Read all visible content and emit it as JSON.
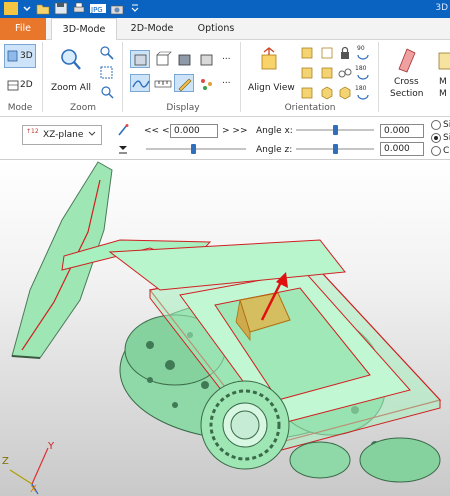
{
  "window": {
    "title": "3D"
  },
  "tabs": [
    {
      "label": "File"
    },
    {
      "label": "3D-Mode"
    },
    {
      "label": "2D-Mode"
    },
    {
      "label": "Options"
    }
  ],
  "ribbon": {
    "mode": {
      "btn_3d": "3D",
      "btn_2d": "2D",
      "label": "Mode"
    },
    "zoom": {
      "zoom_all": "Zoom All",
      "label": "Zoom"
    },
    "display": {
      "label": "Display",
      "more": "..."
    },
    "orientation": {
      "align_view": "Align View",
      "label": "Orientation",
      "rot_90": "90",
      "rot_180a": "180",
      "rot_180b": "180"
    },
    "cross_section": {
      "line1": "Cross",
      "line2": "Section"
    },
    "cut": {
      "line1": "M",
      "line2": "M"
    }
  },
  "toolbar": {
    "plane": "XZ-plane",
    "plane_badge": "↑12",
    "step_left": "<<  <",
    "step_right": ">  >>",
    "position_value": "0.000",
    "angle_x_label": "Angle x:",
    "angle_x_value": "0.000",
    "angle_z_label": "Angle z:",
    "angle_z_value": "0.000",
    "radio_1": "Si",
    "radio_2": "Si",
    "radio_3": "C"
  },
  "viewport": {
    "axis_y": "Y",
    "axis_z": "Z",
    "axis_x": "X"
  },
  "colors": {
    "title_bar": "#0b63c1",
    "file_tab": "#e8762b",
    "model_fill": "#a7f0c0",
    "model_edge": "#d02020",
    "highlight_box": "#f0a830",
    "arrow": "#e01010"
  }
}
